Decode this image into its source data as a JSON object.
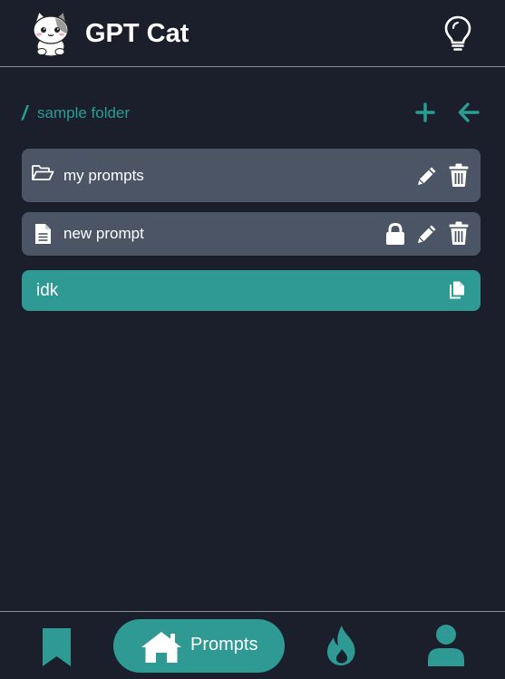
{
  "header": {
    "title": "GPT Cat",
    "logo_icon": "cat-logo-icon",
    "ideas_icon": "lightbulb-icon"
  },
  "breadcrumb": {
    "separator": "/",
    "folder": "sample folder",
    "add_icon": "plus-icon",
    "back_icon": "arrow-left-icon"
  },
  "items": [
    {
      "type": "folder",
      "label": "my prompts",
      "icon": "folder-open-icon",
      "actions": [
        "pencil-icon",
        "trash-icon"
      ]
    },
    {
      "type": "prompt",
      "label": "new prompt",
      "icon": "file-lines-icon",
      "actions": [
        "lock-icon",
        "pencil-icon",
        "trash-icon"
      ]
    },
    {
      "type": "snippet",
      "label": "idk",
      "actions": [
        "copy-icon"
      ]
    }
  ],
  "bottom_nav": {
    "items": [
      {
        "icon": "bookmark-icon",
        "active": false
      },
      {
        "icon": "home-icon",
        "label": "Prompts",
        "active": true
      },
      {
        "icon": "fire-icon",
        "active": false
      },
      {
        "icon": "user-icon",
        "active": false
      }
    ]
  },
  "colors": {
    "background": "#1b1f2b",
    "accent": "#2f9993",
    "accent_text": "#2a9d95",
    "row": "#4b5566",
    "divider": "#8a909c"
  }
}
